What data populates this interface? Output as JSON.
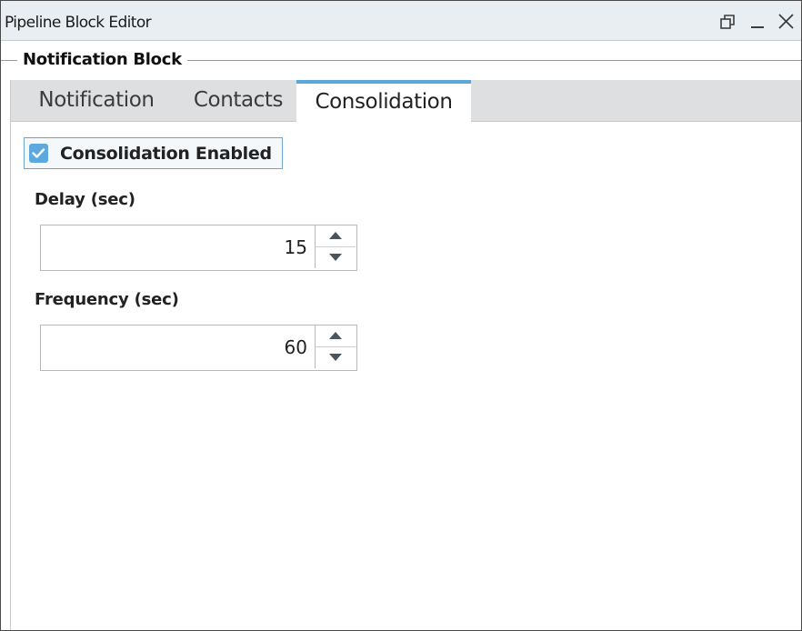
{
  "window": {
    "title": "Pipeline Block Editor",
    "buttons": [
      "restore-icon",
      "minimize-icon",
      "close-icon"
    ]
  },
  "block": {
    "legend": "Notification Block"
  },
  "tabs": [
    {
      "label": "Notification",
      "active": false
    },
    {
      "label": "Contacts",
      "active": false
    },
    {
      "label": "Consolidation",
      "active": true
    }
  ],
  "consolidation": {
    "enabled_label": "Consolidation Enabled",
    "enabled": true,
    "delay_label": "Delay (sec)",
    "delay_value": "15",
    "frequency_label": "Frequency (sec)",
    "frequency_value": "60"
  },
  "colors": {
    "accent": "#5aa7d8",
    "checkbox": "#5ca8df",
    "titlebar": "#e9eef3",
    "tabstrip": "#dddfe1"
  }
}
